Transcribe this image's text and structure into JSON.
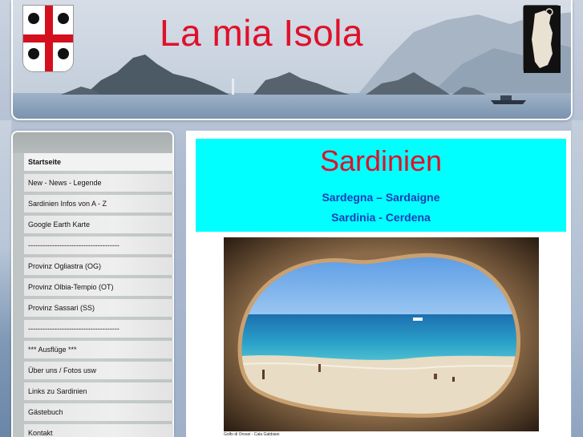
{
  "site": {
    "title": "La mia Isola",
    "title_color": "#e0102a"
  },
  "icons": {
    "crest": "four-moors-flag-icon",
    "island": "sardinia-island-map-icon"
  },
  "sidebar": {
    "items": [
      {
        "label": "Startseite",
        "active": true
      },
      {
        "label": "New - News - Legende"
      },
      {
        "label": "Sardinien Infos von A - Z"
      },
      {
        "label": "Google Earth Karte"
      },
      {
        "label": "--------------------------------------"
      },
      {
        "label": "Provinz Ogliastra (OG)"
      },
      {
        "label": "Provinz Olbia-Tempio (OT)"
      },
      {
        "label": "Provinz Sassari (SS)"
      },
      {
        "label": "--------------------------------------"
      },
      {
        "label": "*** Ausflüge ***"
      },
      {
        "label": "Über uns / Fotos usw"
      },
      {
        "label": "Links zu Sardinien"
      },
      {
        "label": "Gästebuch"
      },
      {
        "label": "Kontakt"
      }
    ]
  },
  "main": {
    "banner": {
      "title": "Sardinien",
      "line1": "Sardegna – Sardaigne",
      "line2": "Sardinia - Cerdena",
      "background": "#00ffff",
      "subtitle_color": "#1a3db5"
    },
    "photo": {
      "caption": "Golfo di Orosei - Cala Gabbiani"
    }
  }
}
